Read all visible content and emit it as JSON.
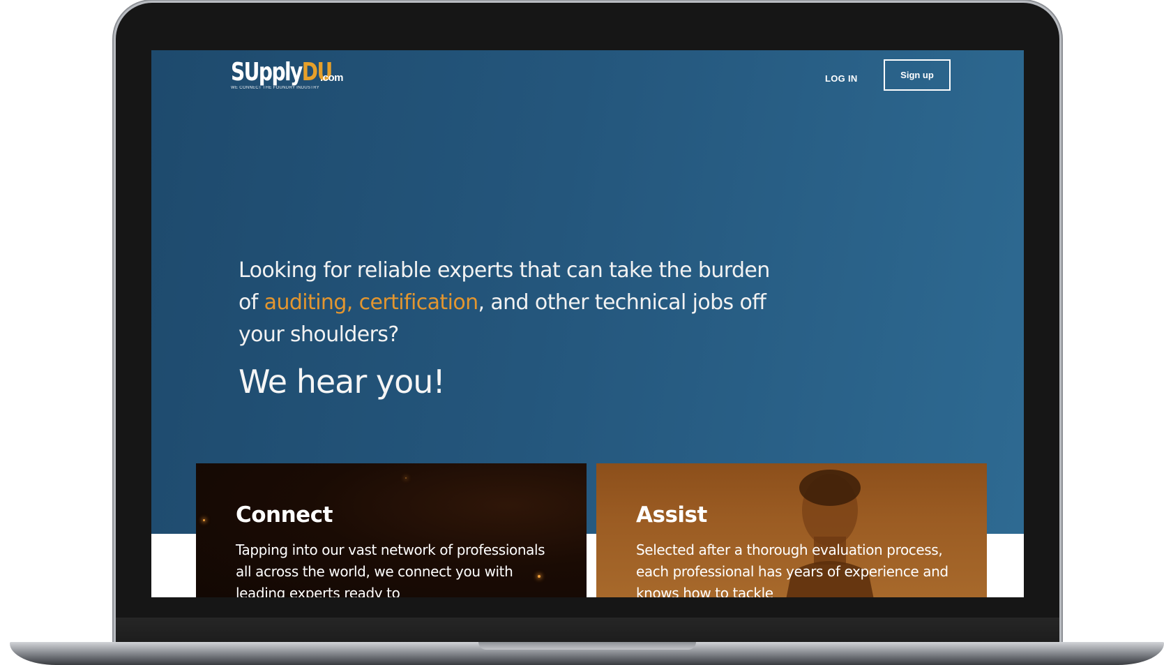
{
  "logo": {
    "name_part1": "SUpply",
    "name_part2": "DU",
    "tld": ".com",
    "tagline": "WE CONNECT THE FOUNDRY INDUSTRY"
  },
  "nav": {
    "login_label": "LOG IN",
    "signup_label": "Sign up"
  },
  "hero": {
    "headline_before": "Looking for reliable experts that can take the burden of ",
    "headline_highlight": "auditing, certification",
    "headline_after": ", and other technical jobs off your shoulders?",
    "subheadline": "We hear you!"
  },
  "cards": [
    {
      "title": "Connect",
      "body": "Tapping into our vast network of professionals all across the world, we connect you with leading experts ready to"
    },
    {
      "title": "Assist",
      "body": "Selected after a thorough evaluation process, each professional has years of experience and knows how to tackle"
    }
  ],
  "colors": {
    "hero_blue": "#24567c",
    "accent_orange": "#e3962f",
    "logo_orange": "#e6a02a"
  }
}
